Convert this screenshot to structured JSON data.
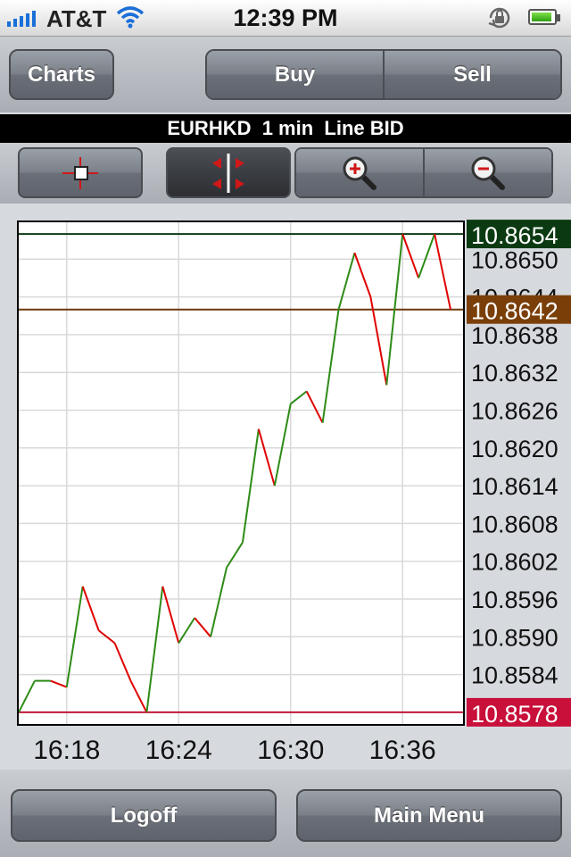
{
  "status": {
    "carrier": "AT&T",
    "time": "12:39 PM",
    "icons": [
      "signal-bars-icon",
      "wifi-icon",
      "rotation-lock-icon",
      "battery-icon"
    ]
  },
  "toolbar": {
    "charts_label": "Charts",
    "buy_label": "Buy",
    "sell_label": "Sell"
  },
  "chart_title": "EURHKD  1 min  Line BID",
  "chart_tools": {
    "crosshair_icon": "crosshair-icon",
    "pan_icon": "pan-arrows-icon",
    "zoom_in_icon": "zoom-in-icon",
    "zoom_out_icon": "zoom-out-icon",
    "active_tool": "pan"
  },
  "chart_data": {
    "type": "line",
    "x_tick_labels": [
      "16:18",
      "16:24",
      "16:30",
      "16:36"
    ],
    "x_tick_index": [
      3,
      10,
      17,
      24
    ],
    "y_tick_labels": [
      "10.8650",
      "10.8644",
      "10.8638",
      "10.8632",
      "10.8626",
      "10.8620",
      "10.8614",
      "10.8608",
      "10.8602",
      "10.8596",
      "10.8590",
      "10.8584"
    ],
    "ylim": [
      10.8576,
      10.8656
    ],
    "values": [
      10.8578,
      10.8583,
      10.8583,
      10.8582,
      10.8598,
      10.8591,
      10.8589,
      10.8583,
      10.8578,
      10.8598,
      10.8589,
      10.8593,
      10.859,
      10.8601,
      10.8605,
      10.8623,
      10.8614,
      10.8627,
      10.8629,
      10.8624,
      10.8642,
      10.8651,
      10.8644,
      10.863,
      10.8654,
      10.8647,
      10.8654,
      10.8642
    ],
    "up_color": "#2e8b17",
    "down_color": "#e00000",
    "high": {
      "value": "10.8654",
      "line_color": "#0b3a12",
      "label_bg": "#0b3a12"
    },
    "current": {
      "value": "10.8642",
      "line_color": "#6b3a0c",
      "label_bg": "#7a3f08"
    },
    "low": {
      "value": "10.8578",
      "line_color": "#c0183c",
      "label_bg": "#c8103a"
    },
    "grid": true
  },
  "bottom": {
    "logoff_label": "Logoff",
    "main_menu_label": "Main Menu"
  }
}
